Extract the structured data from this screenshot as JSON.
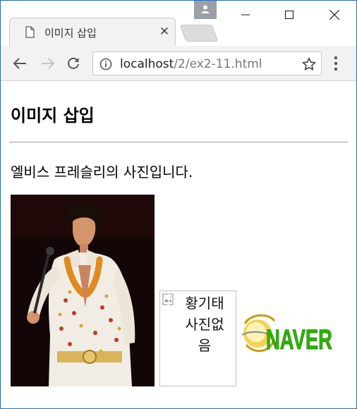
{
  "browser": {
    "tab_title": "이미지 삽입",
    "url_host": "localhost",
    "url_path": "/2/ex2-11.html"
  },
  "page": {
    "heading": "이미지 삽입",
    "paragraph": "엘비스 프레슬리의 사진입니다.",
    "broken_image_alt_lines": [
      "황기태",
      "사진없",
      "음"
    ],
    "logo_text": "NAVER"
  },
  "colors": {
    "window_border": "#1f6fb2",
    "toolbar_bg": "#f2f2f2",
    "naver_green": "#2db400",
    "naver_gold": "#e4b200"
  }
}
